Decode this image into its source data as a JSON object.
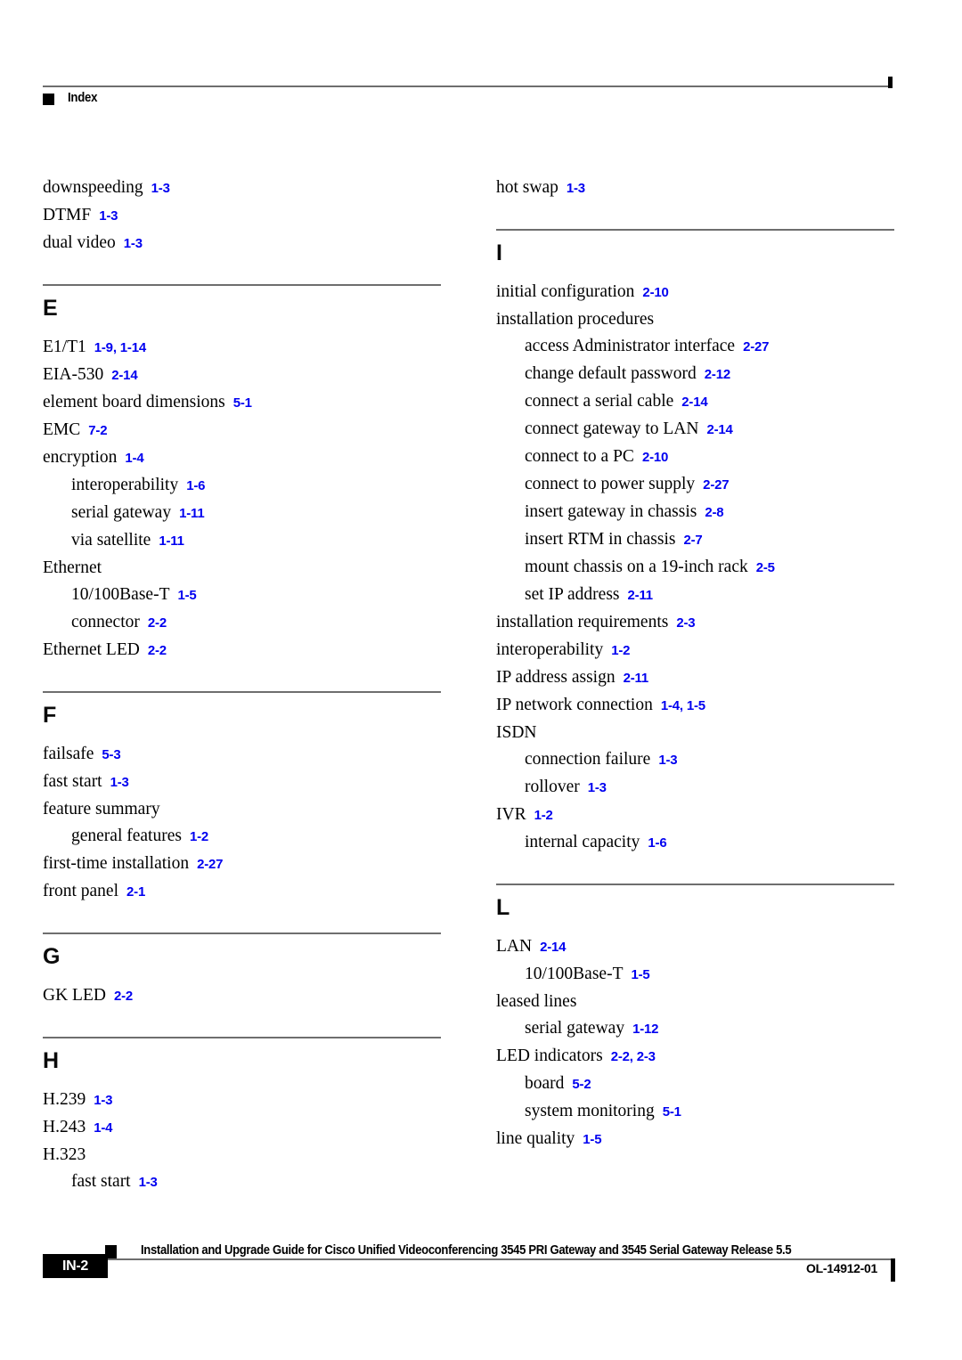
{
  "header": {
    "title": "Index",
    "bullet_icon": "square-bullet-icon"
  },
  "columns": {
    "left": [
      {
        "letter": null,
        "divider": false,
        "entries": [
          {
            "term": "downspeeding",
            "pages": "1-3",
            "level": 0
          },
          {
            "term": "DTMF",
            "pages": "1-3",
            "level": 0
          },
          {
            "term": "dual video",
            "pages": "1-3",
            "level": 0
          }
        ]
      },
      {
        "letter": "E",
        "divider": true,
        "entries": [
          {
            "term": "E1/T1",
            "pages": "1-9, 1-14",
            "level": 0
          },
          {
            "term": "EIA-530",
            "pages": "2-14",
            "level": 0
          },
          {
            "term": "element board dimensions",
            "pages": "5-1",
            "level": 0
          },
          {
            "term": "EMC",
            "pages": "7-2",
            "level": 0
          },
          {
            "term": "encryption",
            "pages": "1-4",
            "level": 0
          },
          {
            "term": "interoperability",
            "pages": "1-6",
            "level": 1
          },
          {
            "term": "serial gateway",
            "pages": "1-11",
            "level": 1
          },
          {
            "term": "via satellite",
            "pages": "1-11",
            "level": 1
          },
          {
            "term": "Ethernet",
            "pages": "",
            "level": 0
          },
          {
            "term": "10/100Base-T",
            "pages": "1-5",
            "level": 1
          },
          {
            "term": "connector",
            "pages": "2-2",
            "level": 1
          },
          {
            "term": "Ethernet LED",
            "pages": "2-2",
            "level": 0
          }
        ]
      },
      {
        "letter": "F",
        "divider": true,
        "entries": [
          {
            "term": "failsafe",
            "pages": "5-3",
            "level": 0
          },
          {
            "term": "fast start",
            "pages": "1-3",
            "level": 0
          },
          {
            "term": "feature summary",
            "pages": "",
            "level": 0
          },
          {
            "term": "general features",
            "pages": "1-2",
            "level": 1
          },
          {
            "term": "first-time installation",
            "pages": "2-27",
            "level": 0
          },
          {
            "term": "front panel",
            "pages": "2-1",
            "level": 0
          }
        ]
      },
      {
        "letter": "G",
        "divider": true,
        "entries": [
          {
            "term": "GK LED",
            "pages": "2-2",
            "level": 0
          }
        ]
      },
      {
        "letter": "H",
        "divider": true,
        "entries": [
          {
            "term": "H.239",
            "pages": "1-3",
            "level": 0
          },
          {
            "term": "H.243",
            "pages": "1-4",
            "level": 0
          },
          {
            "term": "H.323",
            "pages": "",
            "level": 0
          },
          {
            "term": "fast start",
            "pages": "1-3",
            "level": 1
          }
        ]
      }
    ],
    "right": [
      {
        "letter": null,
        "divider": false,
        "entries": [
          {
            "term": "hot swap",
            "pages": "1-3",
            "level": 0
          }
        ]
      },
      {
        "letter": "I",
        "divider": true,
        "entries": [
          {
            "term": "initial configuration",
            "pages": "2-10",
            "level": 0
          },
          {
            "term": "installation procedures",
            "pages": "",
            "level": 0
          },
          {
            "term": "access Administrator interface",
            "pages": "2-27",
            "level": 1
          },
          {
            "term": "change default password",
            "pages": "2-12",
            "level": 1
          },
          {
            "term": "connect a serial cable",
            "pages": "2-14",
            "level": 1
          },
          {
            "term": "connect gateway to LAN",
            "pages": "2-14",
            "level": 1
          },
          {
            "term": "connect to a PC",
            "pages": "2-10",
            "level": 1
          },
          {
            "term": "connect to power supply",
            "pages": "2-27",
            "level": 1
          },
          {
            "term": "insert gateway in chassis",
            "pages": "2-8",
            "level": 1
          },
          {
            "term": "insert RTM in chassis",
            "pages": "2-7",
            "level": 1
          },
          {
            "term": "mount chassis on a 19-inch rack",
            "pages": "2-5",
            "level": 1
          },
          {
            "term": "set IP address",
            "pages": "2-11",
            "level": 1
          },
          {
            "term": "installation requirements",
            "pages": "2-3",
            "level": 0
          },
          {
            "term": "interoperability",
            "pages": "1-2",
            "level": 0
          },
          {
            "term": "IP address assign",
            "pages": "2-11",
            "level": 0
          },
          {
            "term": "IP network connection",
            "pages": "1-4, 1-5",
            "level": 0
          },
          {
            "term": "ISDN",
            "pages": "",
            "level": 0
          },
          {
            "term": "connection failure",
            "pages": "1-3",
            "level": 1
          },
          {
            "term": "rollover",
            "pages": "1-3",
            "level": 1
          },
          {
            "term": "IVR",
            "pages": "1-2",
            "level": 0
          },
          {
            "term": "internal capacity",
            "pages": "1-6",
            "level": 1
          }
        ]
      },
      {
        "letter": "L",
        "divider": true,
        "entries": [
          {
            "term": "LAN",
            "pages": "2-14",
            "level": 0
          },
          {
            "term": "10/100Base-T",
            "pages": "1-5",
            "level": 1
          },
          {
            "term": "leased lines",
            "pages": "",
            "level": 0
          },
          {
            "term": "serial gateway",
            "pages": "1-12",
            "level": 1
          },
          {
            "term": "LED indicators",
            "pages": "2-2, 2-3",
            "level": 0
          },
          {
            "term": "board",
            "pages": "5-2",
            "level": 1
          },
          {
            "term": "system monitoring",
            "pages": "5-1",
            "level": 1
          },
          {
            "term": "line quality",
            "pages": "1-5",
            "level": 0
          }
        ]
      }
    ]
  },
  "footer": {
    "document_title": "Installation and Upgrade Guide for Cisco Unified Videoconferencing 3545 PRI Gateway and 3545 Serial Gateway Release 5.5",
    "page_number": "IN-2",
    "doc_id": "OL-14912-01"
  },
  "colors": {
    "page_reference": "#0000f0",
    "rule": "#6e6e6e",
    "text": "#000000"
  }
}
